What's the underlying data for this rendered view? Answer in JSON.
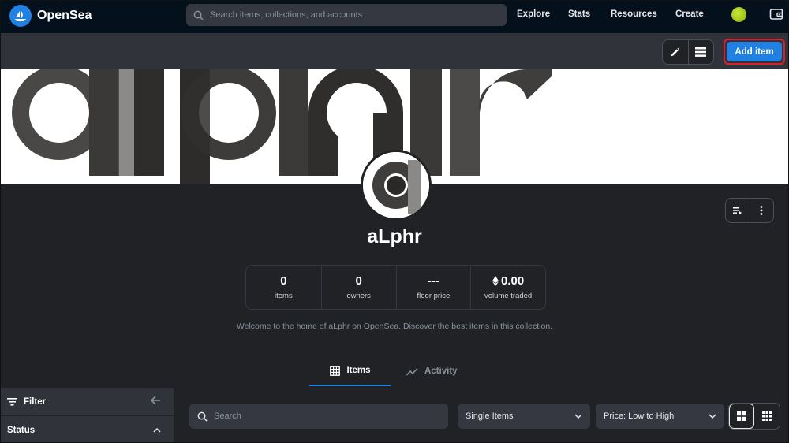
{
  "nav": {
    "brand": "OpenSea",
    "search_placeholder": "Search items, collections, and accounts",
    "links": [
      "Explore",
      "Stats",
      "Resources",
      "Create"
    ]
  },
  "toolbar": {
    "add_item_label": "Add item",
    "edit_icon": "pencil-icon",
    "list_icon": "list-icon"
  },
  "collection": {
    "name": "aLphr",
    "description": "Welcome to the home of aLphr on OpenSea. Discover the best items in this collection.",
    "stats": [
      {
        "value": "0",
        "label": "items"
      },
      {
        "value": "0",
        "label": "owners"
      },
      {
        "value": "---",
        "label": "floor price"
      },
      {
        "value": "0.00",
        "label": "volume traded",
        "icon": "ethereum-icon"
      }
    ]
  },
  "tabs": [
    {
      "label": "Items",
      "icon": "grid-icon",
      "active": true
    },
    {
      "label": "Activity",
      "icon": "activity-icon",
      "active": false
    }
  ],
  "sidebar": {
    "filter_label": "Filter",
    "status_label": "Status"
  },
  "main": {
    "search_placeholder": "Search",
    "type_select": "Single Items",
    "sort_select": "Price: Low to High"
  },
  "colors": {
    "accent": "#2081e2",
    "nav_bg": "#04111d",
    "page_bg": "#202225",
    "highlight_border": "#e11d2a"
  }
}
